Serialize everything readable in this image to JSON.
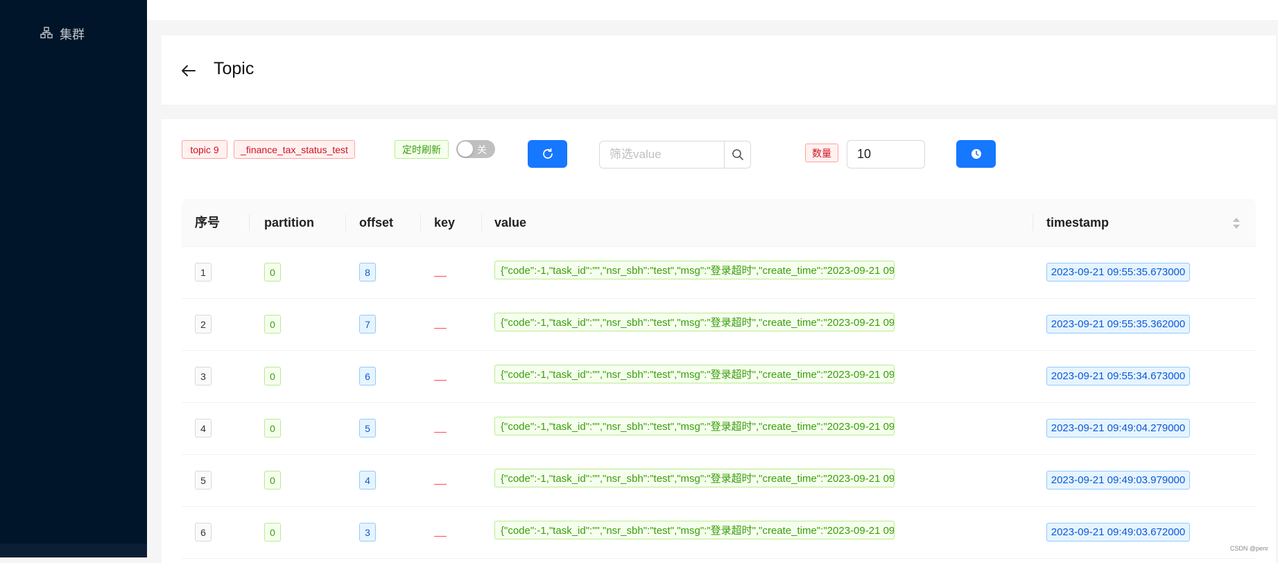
{
  "sidebar": {
    "items": [
      {
        "label": "集群",
        "icon": "cluster-icon"
      }
    ]
  },
  "header": {
    "title": "Topic",
    "back_icon": "arrow-left-icon"
  },
  "toolbar": {
    "topic_tags": [
      "topic 9",
      "_finance_tax_status_test"
    ],
    "auto_refresh_label": "定时刷新",
    "switch_off_label": "关",
    "refresh_icon": "reload-icon",
    "search_placeholder": "筛选value",
    "search_icon": "search-icon",
    "count_label": "数量",
    "count_value": "10",
    "clock_icon": "clock-icon"
  },
  "table": {
    "columns": [
      "序号",
      "partition",
      "offset",
      "key",
      "value",
      "timestamp"
    ],
    "rows": [
      {
        "index": "1",
        "partition": "0",
        "offset": "8",
        "key": "—",
        "value": "{\"code\":-1,\"task_id\":\"\",\"nsr_sbh\":\"test\",\"msg\":\"登录超时\",\"create_time\":\"2023-09-21 09:",
        "timestamp": "2023-09-21 09:55:35.673000"
      },
      {
        "index": "2",
        "partition": "0",
        "offset": "7",
        "key": "—",
        "value": "{\"code\":-1,\"task_id\":\"\",\"nsr_sbh\":\"test\",\"msg\":\"登录超时\",\"create_time\":\"2023-09-21 09:",
        "timestamp": "2023-09-21 09:55:35.362000"
      },
      {
        "index": "3",
        "partition": "0",
        "offset": "6",
        "key": "—",
        "value": "{\"code\":-1,\"task_id\":\"\",\"nsr_sbh\":\"test\",\"msg\":\"登录超时\",\"create_time\":\"2023-09-21 09:",
        "timestamp": "2023-09-21 09:55:34.673000"
      },
      {
        "index": "4",
        "partition": "0",
        "offset": "5",
        "key": "—",
        "value": "{\"code\":-1,\"task_id\":\"\",\"nsr_sbh\":\"test\",\"msg\":\"登录超时\",\"create_time\":\"2023-09-21 09:",
        "timestamp": "2023-09-21 09:49:04.279000"
      },
      {
        "index": "5",
        "partition": "0",
        "offset": "4",
        "key": "—",
        "value": "{\"code\":-1,\"task_id\":\"\",\"nsr_sbh\":\"test\",\"msg\":\"登录超时\",\"create_time\":\"2023-09-21 09:",
        "timestamp": "2023-09-21 09:49:03.979000"
      },
      {
        "index": "6",
        "partition": "0",
        "offset": "3",
        "key": "—",
        "value": "{\"code\":-1,\"task_id\":\"\",\"nsr_sbh\":\"test\",\"msg\":\"登录超时\",\"create_time\":\"2023-09-21 09:",
        "timestamp": "2023-09-21 09:49:03.672000"
      }
    ]
  },
  "watermark": "CSDN @penr",
  "colors": {
    "sidebar": "#001529",
    "primary": "#1677ff"
  }
}
